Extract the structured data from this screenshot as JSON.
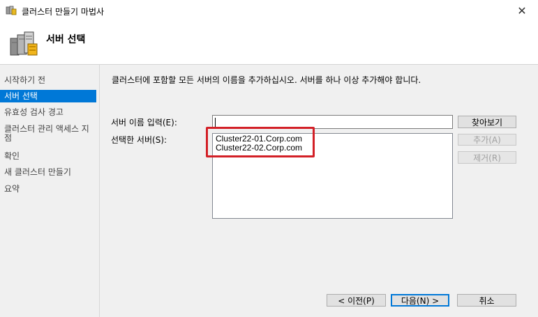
{
  "window": {
    "title": "클러스터 만들기 마법사",
    "close_glyph": "✕",
    "icon": "cluster-wizard-icon"
  },
  "header": {
    "title": "서버 선택",
    "icon": "server-cluster-icon"
  },
  "sidebar": {
    "items": [
      {
        "label": "시작하기 전",
        "selected": false
      },
      {
        "label": "서버 선택",
        "selected": true
      },
      {
        "label": "유효성 검사 경고",
        "selected": false
      },
      {
        "label": "클러스터 관리 액세스 지점",
        "selected": false
      },
      {
        "label": "확인",
        "selected": false
      },
      {
        "label": "새 클러스터 만들기",
        "selected": false
      },
      {
        "label": "요약",
        "selected": false
      }
    ]
  },
  "main": {
    "instruction": "클러스터에 포함할 모든 서버의 이름을 추가하십시오. 서버를 하나 이상 추가해야 합니다.",
    "server_name_label": "서버 이름 입력(E):",
    "server_name_value": "",
    "selected_servers_label": "선택한 서버(S):",
    "selected_servers": [
      "Cluster22-01.Corp.com",
      "Cluster22-02.Corp.com"
    ],
    "browse_button": "찾아보기",
    "add_button": "추가(A)",
    "remove_button": "제거(R)"
  },
  "footer": {
    "back_button": "< 이전(P)",
    "next_button": "다음(N) >",
    "cancel_button": "취소"
  },
  "colors": {
    "accent": "#0078d7",
    "highlight_border": "#d32027",
    "panel_bg": "#f0f0f0"
  }
}
